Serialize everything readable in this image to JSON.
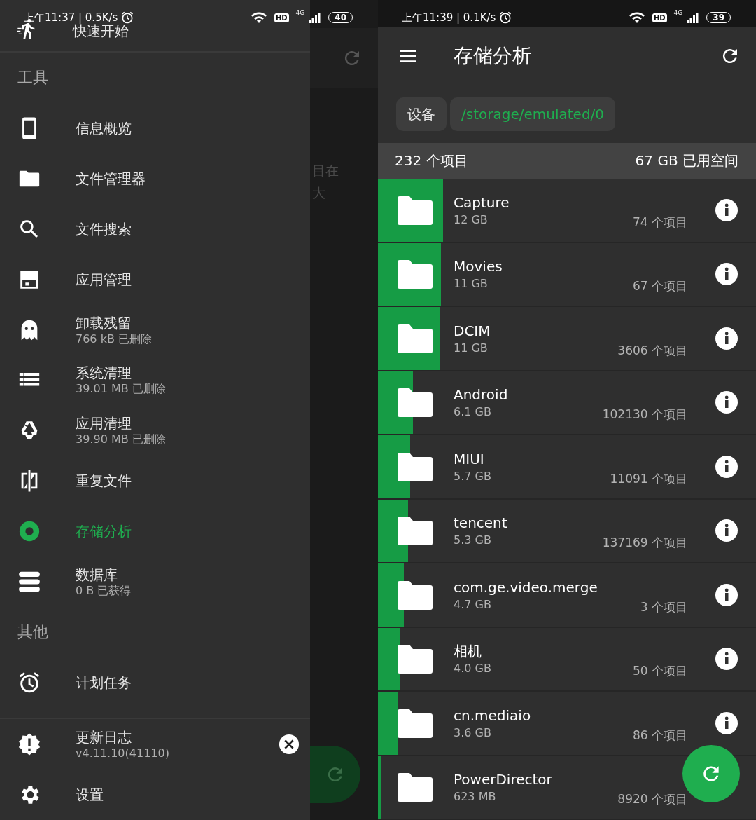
{
  "left_screen": {
    "status_bar": {
      "time": "上午11:37 | 0.5K/s",
      "hd": "HD",
      "network": "4G",
      "battery": "40"
    },
    "drawer": {
      "top_item": {
        "label": "快速开始"
      },
      "sections": [
        {
          "header": "工具",
          "items": [
            {
              "label": "信息概览",
              "selected": false
            },
            {
              "label": "文件管理器",
              "selected": false
            },
            {
              "label": "文件搜索",
              "selected": false
            },
            {
              "label": "应用管理",
              "selected": false
            },
            {
              "label": "卸载残留",
              "subtitle": "766 kB 已删除",
              "selected": false
            },
            {
              "label": "系统清理",
              "subtitle": "39.01 MB 已删除",
              "selected": false
            },
            {
              "label": "应用清理",
              "subtitle": "39.90 MB 已删除",
              "selected": false
            },
            {
              "label": "重复文件",
              "selected": false
            },
            {
              "label": "存储分析",
              "selected": true
            },
            {
              "label": "数据库",
              "subtitle": "0 B 已获得",
              "selected": false
            }
          ]
        },
        {
          "header": "其他",
          "items": [
            {
              "label": "计划任务",
              "selected": false
            }
          ]
        }
      ],
      "footer_items": [
        {
          "label": "更新日志",
          "subtitle": "v4.11.10(41110)",
          "dismissible": true
        },
        {
          "label": "设置",
          "dismissible": false
        }
      ]
    },
    "background_text": [
      "目在",
      "大"
    ]
  },
  "right_screen": {
    "status_bar": {
      "time": "上午11:39 | 0.1K/s",
      "hd": "HD",
      "network": "4G",
      "battery": "39"
    },
    "app_bar": {
      "title": "存储分析"
    },
    "breadcrumbs": [
      {
        "label": "设备",
        "selected": false
      },
      {
        "label": "/storage/emulated/0",
        "selected": true
      }
    ],
    "summary": {
      "count": "232 个项目",
      "used": "67 GB 已用空间"
    },
    "rows": [
      {
        "name": "Capture",
        "size": "12 GB",
        "items": "74 个项目",
        "level": 0.172
      },
      {
        "name": "Movies",
        "size": "11 GB",
        "items": "67 个项目",
        "level": 0.167
      },
      {
        "name": "DCIM",
        "size": "11 GB",
        "items": "3606 个项目",
        "level": 0.163
      },
      {
        "name": "Android",
        "size": "6.1 GB",
        "items": "102130 个项目",
        "level": 0.093
      },
      {
        "name": "MIUI",
        "size": "5.7 GB",
        "items": "11091 个项目",
        "level": 0.085
      },
      {
        "name": "tencent",
        "size": "5.3 GB",
        "items": "137169 个项目",
        "level": 0.08
      },
      {
        "name": "com.ge.video.merge",
        "size": "4.7 GB",
        "items": "3 个项目",
        "level": 0.069
      },
      {
        "name": "相机",
        "size": "4.0 GB",
        "items": "50 个项目",
        "level": 0.059
      },
      {
        "name": "cn.mediaio",
        "size": "3.6 GB",
        "items": "86 个项目",
        "level": 0.054
      },
      {
        "name": "PowerDirector",
        "size": "623 MB",
        "items": "8920 个项目",
        "level": 0.009
      }
    ]
  }
}
